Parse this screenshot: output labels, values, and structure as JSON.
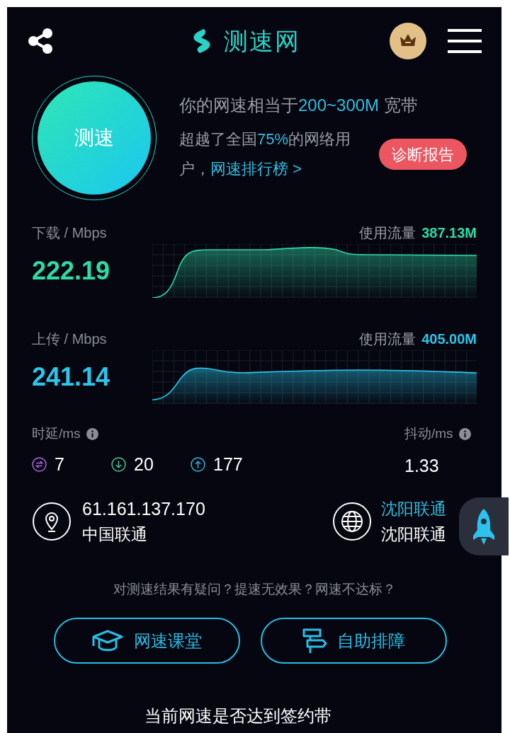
{
  "header": {
    "logo_text": "测速网"
  },
  "speed_button": {
    "label": "测速"
  },
  "summary": {
    "headline": [
      {
        "text": "你的网速相当于",
        "highlight": false
      },
      {
        "text": "200~300M",
        "highlight": true
      },
      {
        "text": " 宽带",
        "highlight": false
      }
    ],
    "detail": [
      {
        "text": "超越了全国",
        "highlight": false
      },
      {
        "text": "75%",
        "highlight": true
      },
      {
        "text": "的网络用户，",
        "highlight": false
      }
    ],
    "ranking_link": "网速排行榜 >",
    "report_button": "诊断报告"
  },
  "metrics": [
    {
      "kind": "download",
      "label": "下载 / Mbps",
      "value": "222.19",
      "usage_label": "使用流量",
      "usage": "387.13M",
      "color": "#2edaa6"
    },
    {
      "kind": "upload",
      "label": "上传 / Mbps",
      "value": "241.14",
      "usage_label": "使用流量",
      "usage": "405.00M",
      "color": "#2bc6ec"
    }
  ],
  "latency": {
    "label": "时延/ms",
    "items": [
      {
        "kind": "exchange",
        "value": "7",
        "color": "#b46ae0"
      },
      {
        "kind": "down",
        "value": "20",
        "color": "#3fcca2"
      },
      {
        "kind": "up",
        "value": "177",
        "color": "#2bbbe0"
      }
    ]
  },
  "jitter": {
    "label": "抖动/ms",
    "value": "1.33"
  },
  "client": {
    "ip": "61.161.137.170",
    "isp": "中国联通"
  },
  "server": {
    "name": "沈阳联通",
    "isp": "沈阳联通"
  },
  "help_text": "对测速结果有疑问？提速无效果？网速不达标？",
  "buttons": [
    {
      "kind": "course",
      "label": "网速课堂"
    },
    {
      "kind": "troubleshoot",
      "label": "自助排障"
    }
  ],
  "footer_text": "当前网速是否达到签约带"
}
